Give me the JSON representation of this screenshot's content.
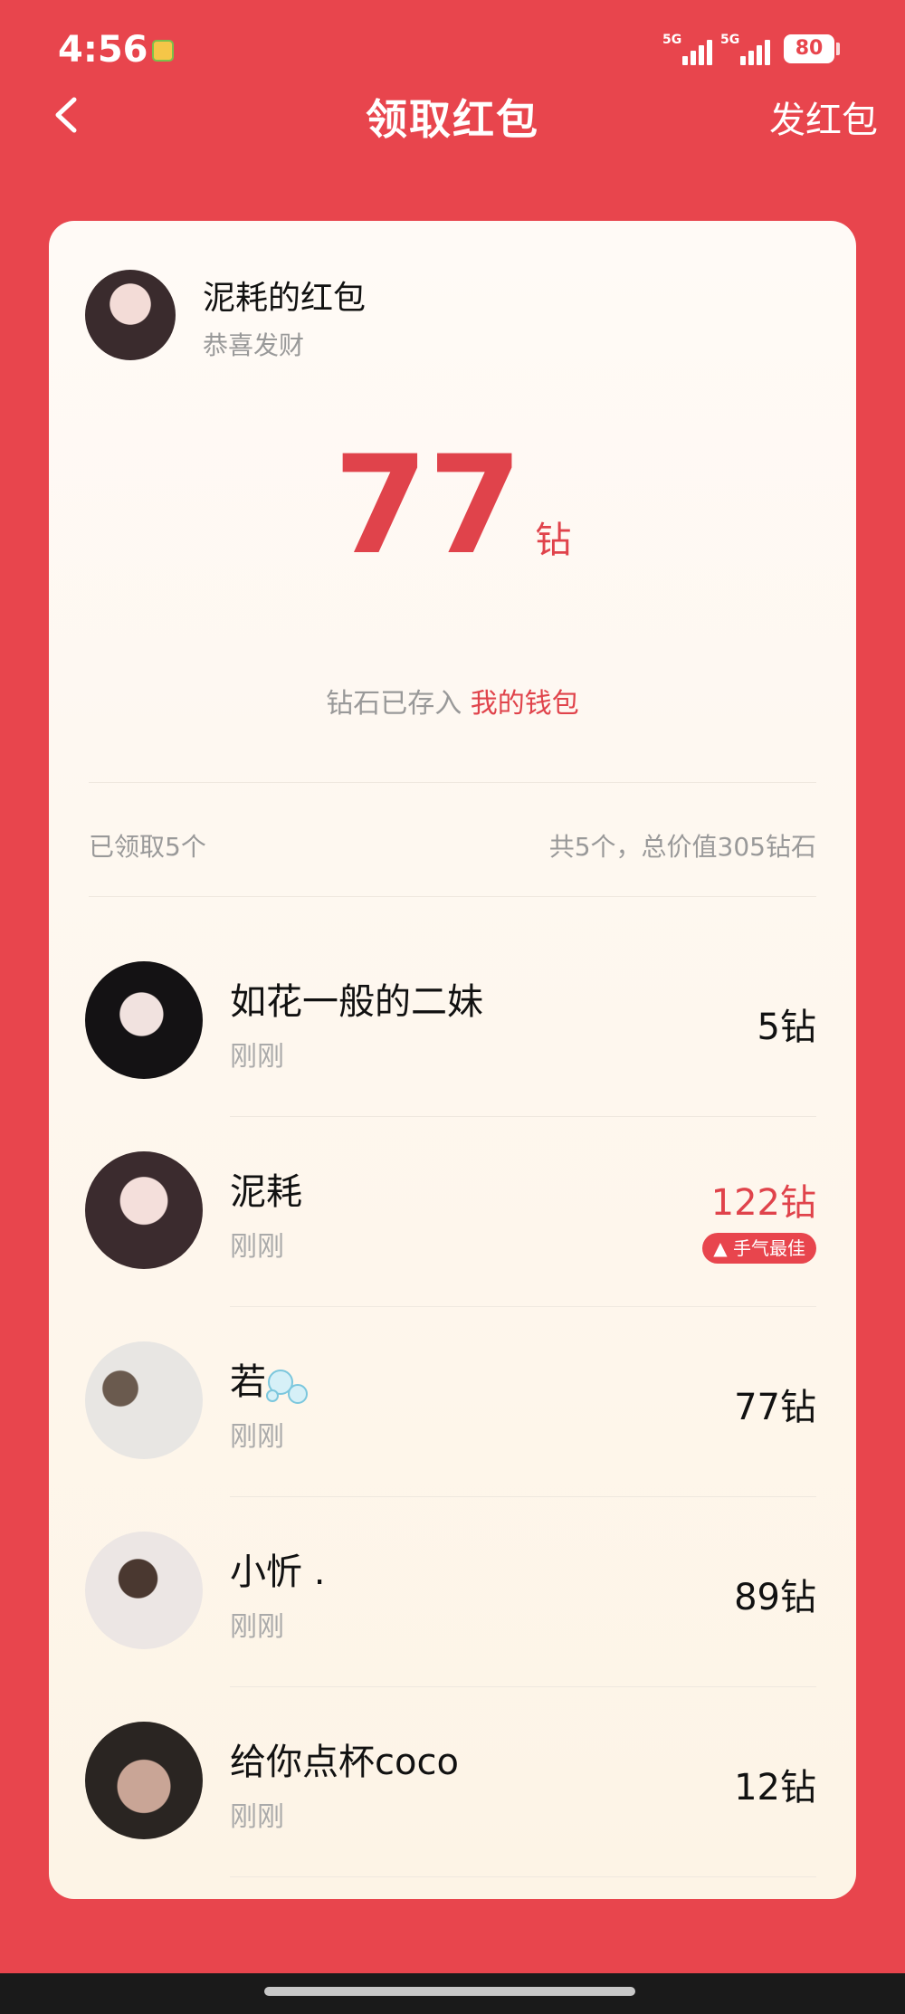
{
  "status": {
    "time": "4:56",
    "signal1": "5G",
    "signal2": "5G",
    "battery": "80"
  },
  "nav": {
    "title": "领取红包",
    "send_label": "发红包"
  },
  "sender": {
    "name": "泥耗的红包",
    "message": "恭喜发财"
  },
  "amount": {
    "value": "77",
    "unit": "钻"
  },
  "deposit": {
    "text": "钻石已存入",
    "wallet_link": "我的钱包"
  },
  "summary": {
    "received": "已领取5个",
    "total": "共5个，总价值305钻石"
  },
  "receivers": [
    {
      "name": "如花一般的二妹",
      "time": "刚刚",
      "amount": "5钻"
    },
    {
      "name": "泥耗",
      "time": "刚刚",
      "amount": "122钻",
      "badge": "手气最佳"
    },
    {
      "name": "若",
      "time": "刚刚",
      "amount": "77钻"
    },
    {
      "name": "小忻 .",
      "time": "刚刚",
      "amount": "89钻"
    },
    {
      "name": "给你点杯coco",
      "time": "刚刚",
      "amount": "12钻"
    }
  ],
  "colors": {
    "background": "#e8454d",
    "accent": "#e0434b",
    "card": "#fdf6ee"
  },
  "icons": {
    "back": "chevron-left-icon",
    "thumb": "thumbs-up-icon",
    "bubbles": "bubbles-emoji"
  }
}
